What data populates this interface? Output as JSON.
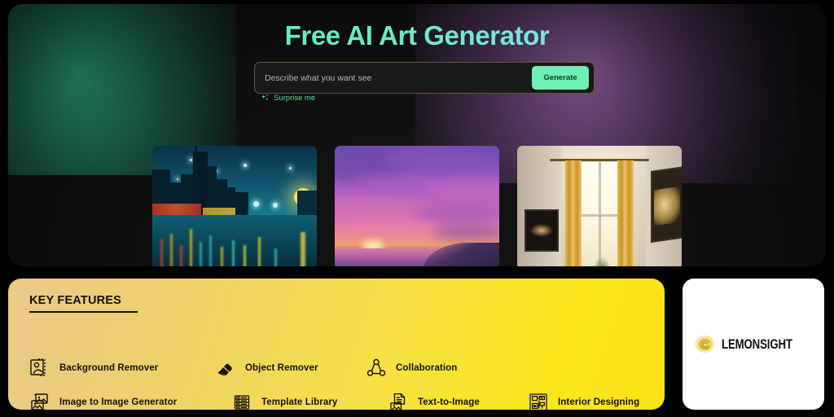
{
  "hero": {
    "title": "Free AI Art Generator",
    "search": {
      "placeholder": "Describe what you want see",
      "value": "",
      "generate_label": "Generate"
    },
    "surprise_label": "Surprise me",
    "surprise_icon": "sparkle-icon",
    "gallery": [
      {
        "name": "night-cityscape-thumbnail",
        "alt": "Night cityscape with illuminated buildings reflected in water under a starry sky"
      },
      {
        "name": "purple-sunset-thumbnail",
        "alt": "Purple and pink sunset clouds over a calm sea"
      },
      {
        "name": "interior-room-thumbnail",
        "alt": "Interior room with golden curtains, a sunlit window and framed artwork"
      }
    ]
  },
  "features": {
    "heading": "KEY FEATURES",
    "items": [
      {
        "label": "Background Remover",
        "icon": "background-remover-icon"
      },
      {
        "label": "Object Remover",
        "icon": "eraser-icon"
      },
      {
        "label": "Collaboration",
        "icon": "share-nodes-icon"
      },
      {
        "label": "Image to Image Generator",
        "icon": "image-stack-icon"
      },
      {
        "label": "Template Library",
        "icon": "template-library-icon"
      },
      {
        "label": "Text-to-Image",
        "icon": "document-image-icon"
      },
      {
        "label": "Interior Designing",
        "icon": "floor-plan-icon"
      }
    ]
  },
  "brand": {
    "name": "LEMONSIGHT",
    "logo_icon": "lemon-spiral-logo"
  },
  "colors": {
    "accent_green": "#6DF0B4",
    "title_gradient_start": "#5EEDB0",
    "title_gradient_end": "#8FDDF0",
    "card_yellow": "#F9E316",
    "card_tan": "#E9C98A",
    "hero_background": "#121212",
    "page_background": "#000000",
    "feature_text": "#16120A"
  }
}
